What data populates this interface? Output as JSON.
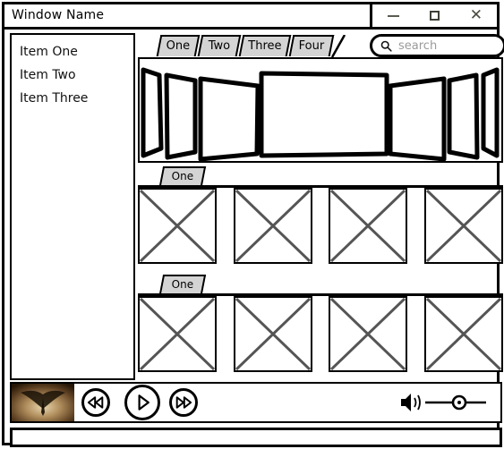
{
  "window": {
    "title": "Window Name",
    "controls": [
      {
        "name": "minimize",
        "label": "—"
      },
      {
        "name": "maximize",
        "label": "□"
      },
      {
        "name": "close",
        "label": "X"
      }
    ]
  },
  "sidebar": {
    "items": [
      {
        "label": "Item One"
      },
      {
        "label": "Item Two"
      },
      {
        "label": "Item Three"
      }
    ]
  },
  "tabs": [
    {
      "label": "One",
      "selected": true
    },
    {
      "label": "Two",
      "selected": false
    },
    {
      "label": "Three",
      "selected": false
    },
    {
      "label": "Four",
      "selected": false
    }
  ],
  "search": {
    "placeholder": "search",
    "value": "",
    "icon": "search-icon"
  },
  "coverflow": {
    "panel_count": 7,
    "selected_index": 3
  },
  "sections": [
    {
      "tab_label": "One",
      "thumbnails": [
        {
          "placeholder": "image-placeholder"
        },
        {
          "placeholder": "image-placeholder"
        },
        {
          "placeholder": "image-placeholder"
        },
        {
          "placeholder": "image-placeholder"
        }
      ]
    },
    {
      "tab_label": "One",
      "thumbnails": [
        {
          "placeholder": "image-placeholder"
        },
        {
          "placeholder": "image-placeholder"
        },
        {
          "placeholder": "image-placeholder"
        },
        {
          "placeholder": "image-placeholder"
        }
      ]
    }
  ],
  "player": {
    "album_art": "album-art-thumbnail",
    "buttons": [
      {
        "name": "previous-button",
        "icon": "rewind-icon"
      },
      {
        "name": "play-button",
        "icon": "play-icon"
      },
      {
        "name": "next-button",
        "icon": "fast-forward-icon"
      }
    ],
    "volume": {
      "icon": "speaker-icon",
      "level_percent": 55
    }
  },
  "status_bar": {
    "text": ""
  },
  "colors": {
    "outline": "#000000",
    "tab_fill": "#d4d4d4",
    "placeholder_text": "#9a9a9a",
    "cross": "#555555",
    "page_bg": "#ffffff"
  }
}
